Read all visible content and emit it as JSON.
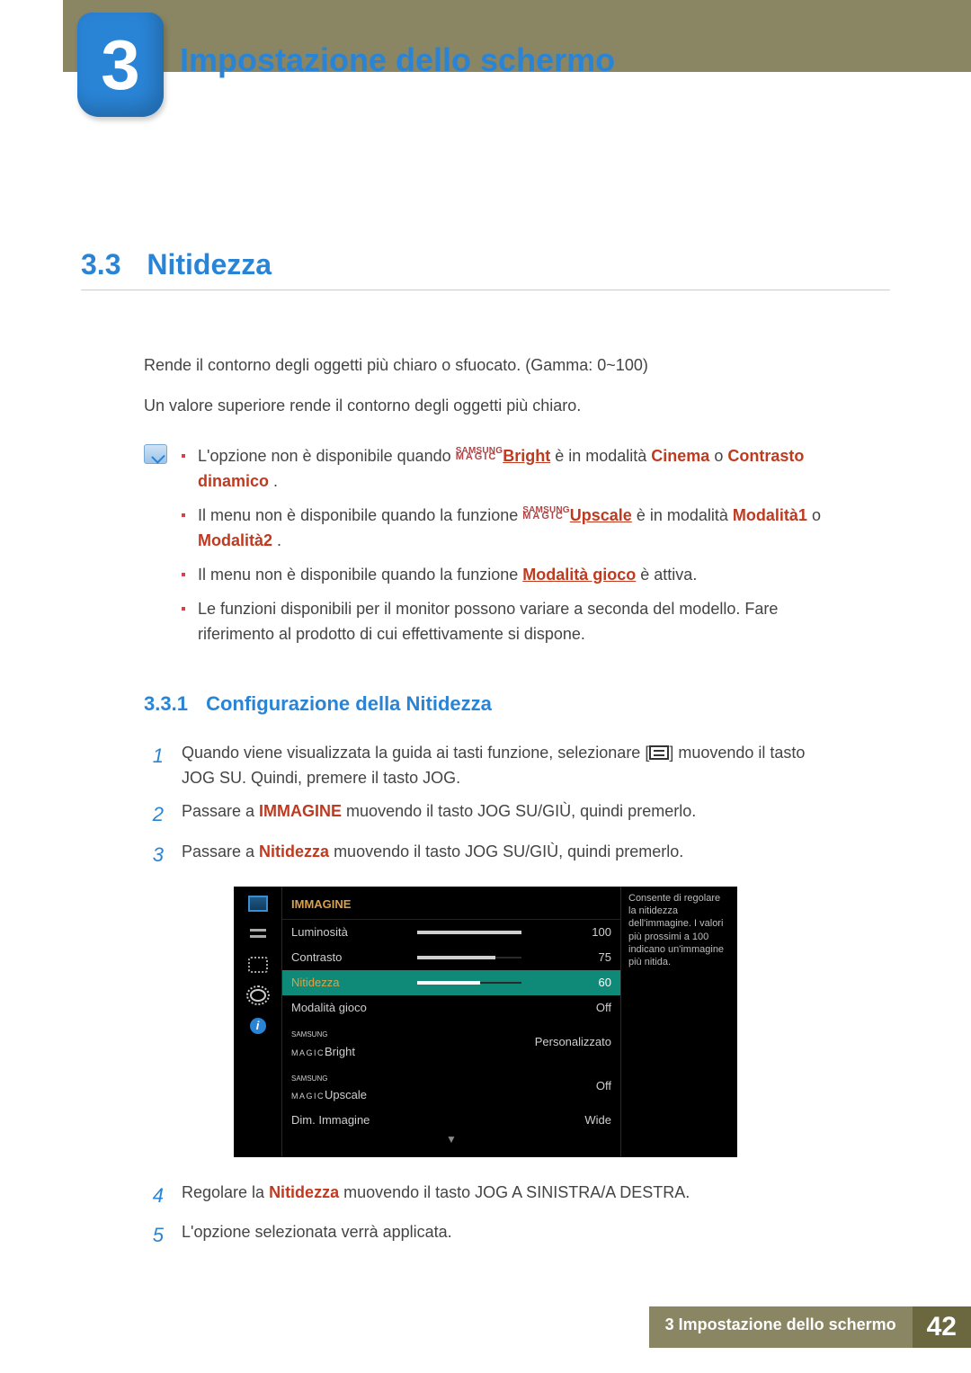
{
  "chapter": {
    "number": "3",
    "title": "Impostazione dello schermo"
  },
  "section": {
    "number": "3.3",
    "title": "Nitidezza",
    "p1": "Rende il contorno degli oggetti più chiaro o sfuocato. (Gamma: 0~100)",
    "p2": "Un valore superiore rende il contorno degli oggetti più chiaro."
  },
  "notes": {
    "n1_a": "L'opzione non è disponibile quando ",
    "n1_b": "Bright",
    "n1_c": " è in modalità ",
    "n1_cinema": "Cinema",
    "n1_o": " o ",
    "n1_dyn": "Contrasto dinamico",
    "n1_end": ".",
    "n2_a": "Il menu non è disponibile quando la funzione ",
    "n2_b": "Upscale",
    "n2_c": " è in modalità ",
    "n2_m1": "Modalità1",
    "n2_o": " o ",
    "n2_m2": "Modalità2",
    "n2_end": ".",
    "n3_a": "Il menu non è disponibile quando la funzione ",
    "n3_b": "Modalità gioco",
    "n3_c": " è attiva.",
    "n4": "Le funzioni disponibili per il monitor possono variare a seconda del modello. Fare riferimento al prodotto di cui effettivamente si dispone."
  },
  "magic": {
    "top": "SAMSUNG",
    "bot": "MAGIC"
  },
  "subsection": {
    "number": "3.3.1",
    "title": "Configurazione della Nitidezza"
  },
  "steps": {
    "s1a": "Quando viene visualizzata la guida ai tasti funzione, selezionare [",
    "s1b": "] muovendo il tasto JOG SU. Quindi, premere il tasto JOG.",
    "s2a": "Passare a ",
    "s2b": "IMMAGINE",
    "s2c": " muovendo il tasto JOG SU/GIÙ, quindi premerlo.",
    "s3a": "Passare a ",
    "s3b": "Nitidezza",
    "s3c": " muovendo il tasto JOG SU/GIÙ, quindi premerlo.",
    "s4a": "Regolare la ",
    "s4b": "Nitidezza",
    "s4c": " muovendo il tasto JOG A SINISTRA/A DESTRA.",
    "s5": "L'opzione selezionata verrà applicata."
  },
  "osd": {
    "header": "IMMAGINE",
    "hint": "Consente di regolare la nitidezza dell'immagine. I valori più prossimi a 100 indicano un'immagine più nitida.",
    "rows": [
      {
        "label": "Luminosità",
        "bar": 100,
        "value": "100"
      },
      {
        "label": "Contrasto",
        "bar": 75,
        "value": "75"
      },
      {
        "label": "Nitidezza",
        "bar": 60,
        "value": "60",
        "selected": true
      },
      {
        "label": "Modalità gioco",
        "value": "Off"
      },
      {
        "label": "Bright",
        "magic": true,
        "value": "Personalizzato"
      },
      {
        "label": "Upscale",
        "magic": true,
        "value": "Off"
      },
      {
        "label": "Dim. Immagine",
        "value": "Wide"
      }
    ]
  },
  "footer": {
    "title": "3 Impostazione dello schermo",
    "page": "42"
  }
}
